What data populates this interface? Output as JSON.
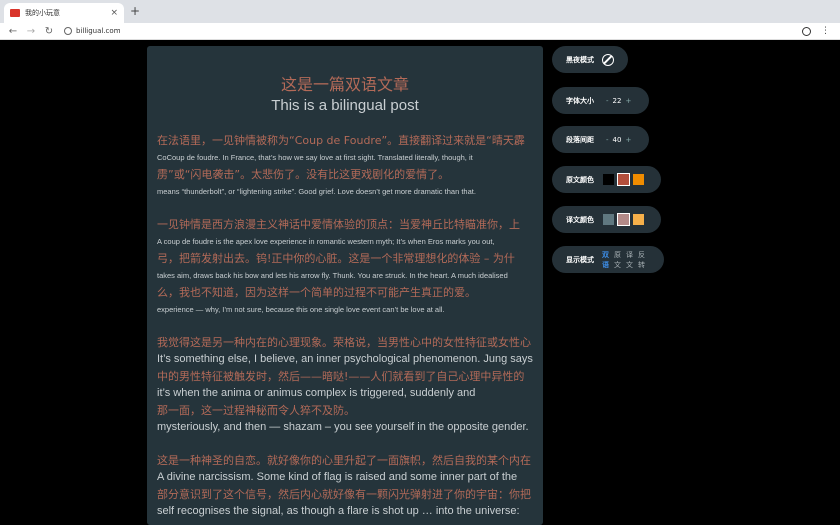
{
  "browser": {
    "tab_title": "我的小玩意",
    "tab_close": "×",
    "new_tab": "+",
    "url": "billigual.com"
  },
  "article": {
    "title_cn": "这是一篇双语文章",
    "title_en": "This is a bilingual post",
    "paragraphs": [
      {
        "style": "small",
        "lines": [
          {
            "lang": "cn",
            "text": "在法语里，一见钟情被称为“Coup de Foudre”。直接翻译过来就是“晴天霹"
          },
          {
            "lang": "en",
            "text": "CoCoup de foudre. In France, that’s how we say love at first sight. Translated literally, though, it"
          },
          {
            "lang": "cn",
            "text": "雳”或“闪电袭击”。太悲伤了。没有比这更戏剧化的爱情了。"
          },
          {
            "lang": "en",
            "text": "means “thunderbolt”, or “lightening strike”. Good grief. Love doesn’t get more dramatic than that."
          }
        ]
      },
      {
        "style": "small",
        "lines": [
          {
            "lang": "cn",
            "text": "一见钟情是西方浪漫主义神话中爱情体验的顶点：当爱神丘比特瞄准你，上"
          },
          {
            "lang": "en",
            "text": "A coup de foudre is the apex love experience in romantic western myth; It’s when Eros marks you out,"
          },
          {
            "lang": "cn",
            "text": "弓，把箭发射出去。钨!正中你的心脏。这是一个非常理想化的体验 – 为什"
          },
          {
            "lang": "en",
            "text": "takes aim, draws back his bow and lets his arrow fly. Thunk. You are struck. In the heart. A much idealised"
          },
          {
            "lang": "cn",
            "text": "么，我也不知道，因为这样一个简单的过程不可能产生真正的爱。"
          },
          {
            "lang": "en",
            "text": "experience — why, I’m not sure, because this one single love event can’t be love at all."
          }
        ]
      },
      {
        "style": "big",
        "lines": [
          {
            "lang": "cn",
            "text": "我觉得这是另一种内在的心理现象。荣格说，当男性心中的女性特征或女性心"
          },
          {
            "lang": "en",
            "text": "It’s something else, I believe, an inner psychological phenomenon. Jung says"
          },
          {
            "lang": "cn",
            "text": "中的男性特征被触发时，然后——暗哒!——人们就看到了自己心理中异性的"
          },
          {
            "lang": "en",
            "text": "it’s when the anima or animus complex is triggered, suddenly and"
          },
          {
            "lang": "cn",
            "text": "那一面，这一过程神秘而令人猝不及防。"
          },
          {
            "lang": "en",
            "text": "mysteriously, and then — shazam – you see yourself in the opposite gender."
          }
        ]
      },
      {
        "style": "big",
        "lines": [
          {
            "lang": "cn",
            "text": "这是一种神圣的自恋。就好像你的心里升起了一面旗帜，然后自我的某个内在"
          },
          {
            "lang": "en",
            "text": "A divine narcissism. Some kind of flag is raised and some inner part of the"
          },
          {
            "lang": "cn",
            "text": "部分意识到了这个信号，然后内心就好像有一颗闪光弹射进了你的宇宙：你把"
          },
          {
            "lang": "en",
            "text": "self recognises the signal, as though a flare is shot up … into the universe:"
          }
        ]
      }
    ]
  },
  "settings": {
    "night_mode": {
      "label": "黑夜模式",
      "icon": "ban-icon"
    },
    "font_size": {
      "label": "字体大小",
      "minus": "-",
      "value": "22",
      "plus": "+"
    },
    "paragraph_spacing": {
      "label": "段落间距",
      "minus": "-",
      "value": "40",
      "plus": "+"
    },
    "source_color": {
      "label": "原文颜色",
      "swatches": [
        "#000000",
        "#b34f3c",
        "#f08c00"
      ],
      "selected": 1
    },
    "translation_color": {
      "label": "译文颜色",
      "swatches": [
        "#607880",
        "#b38a88",
        "#f6b04a"
      ],
      "selected": 1
    },
    "display_mode": {
      "label": "显示模式",
      "options": [
        "双语",
        "原文",
        "译文",
        "反转"
      ],
      "active": 0
    }
  }
}
